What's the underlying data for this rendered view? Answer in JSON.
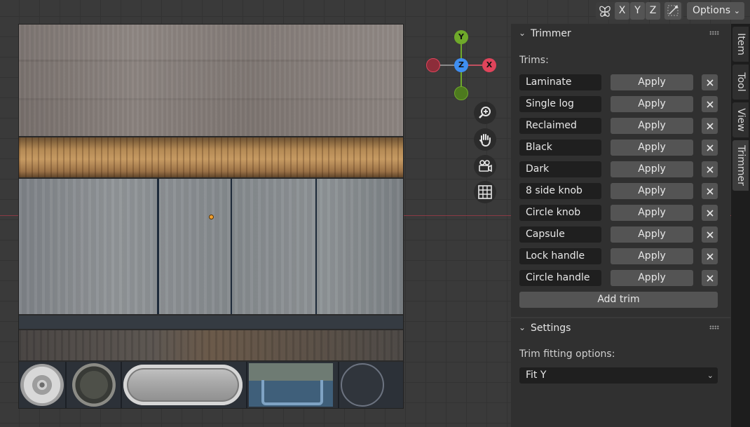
{
  "header": {
    "axes": [
      "X",
      "Y",
      "Z"
    ],
    "options_label": "Options"
  },
  "gizmo": {
    "y_label": "Y",
    "z_label": "Z",
    "x_label": "X",
    "colors": {
      "x": "#e0445b",
      "y": "#6fa92a",
      "z": "#3f8ef0",
      "x_neg": "#8d2d3a",
      "y_neg": "#4d7a1e"
    }
  },
  "nav_icons": [
    "zoom-icon",
    "hand-pan-icon",
    "camera-icon",
    "grid-icon"
  ],
  "side_tabs": [
    "Item",
    "Tool",
    "View",
    "Trimmer"
  ],
  "trimmer": {
    "title": "Trimmer",
    "trims_label": "Trims:",
    "apply_label": "Apply",
    "add_label": "Add trim",
    "trims": [
      {
        "name": "Laminate"
      },
      {
        "name": "Single log"
      },
      {
        "name": "Reclaimed"
      },
      {
        "name": "Black"
      },
      {
        "name": "Dark"
      },
      {
        "name": "8 side knob"
      },
      {
        "name": "Circle knob"
      },
      {
        "name": "Capsule"
      },
      {
        "name": "Lock handle"
      },
      {
        "name": "Circle handle"
      }
    ]
  },
  "settings": {
    "title": "Settings",
    "fitting_label": "Trim fitting options:",
    "fitting_value": "Fit Y"
  }
}
